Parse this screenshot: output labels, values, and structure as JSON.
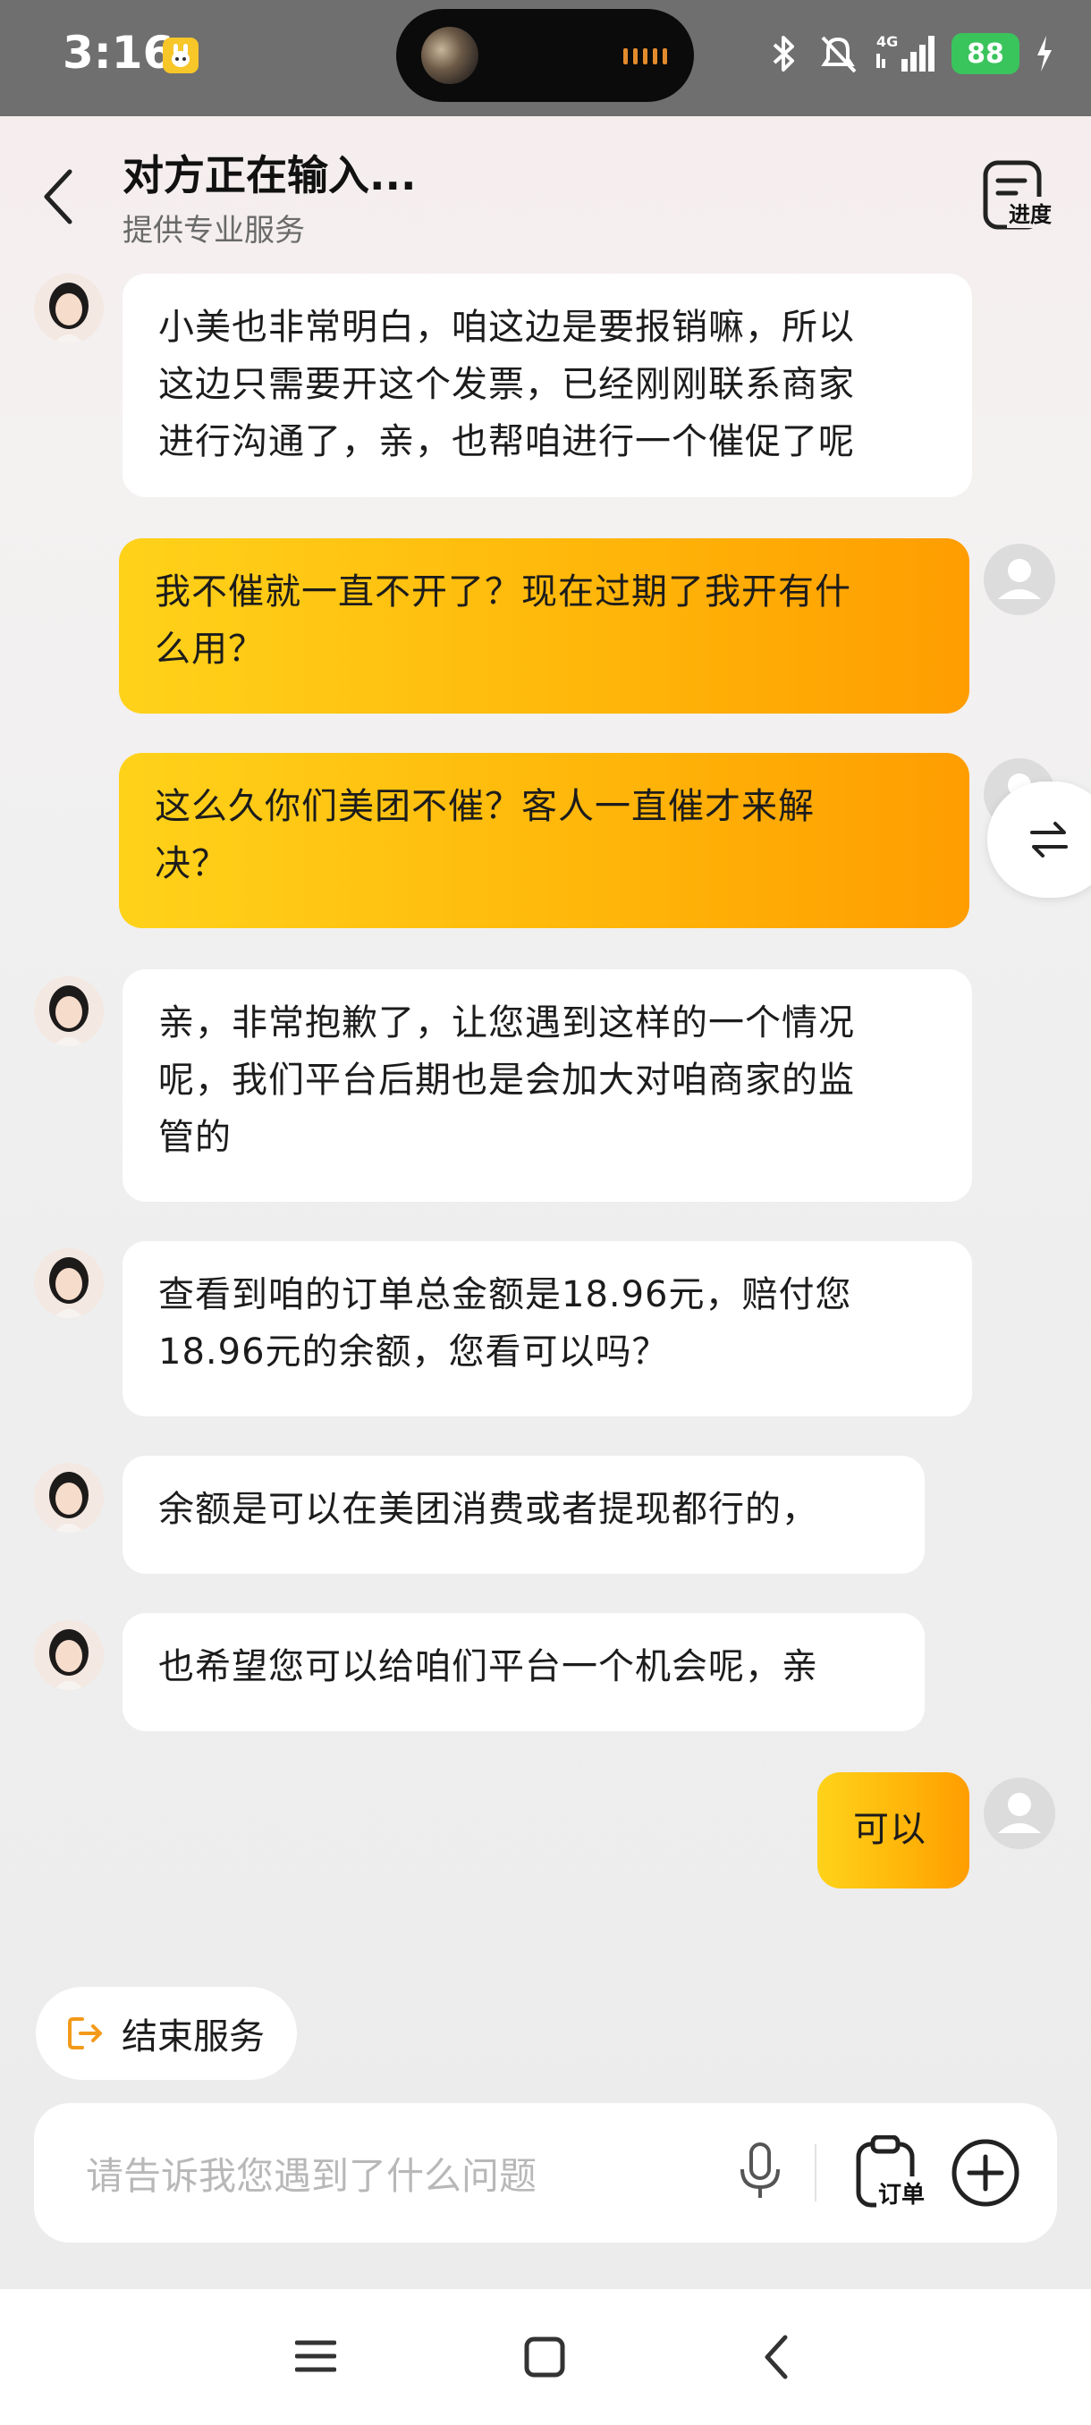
{
  "status_bar": {
    "time": "3:16",
    "network": "4G",
    "battery": "88"
  },
  "header": {
    "title": "对方正在输入...",
    "subtitle": "提供专业服务",
    "progress_label": "进度"
  },
  "messages": [
    {
      "from": "agent",
      "lines": [
        "小美也非常明白，咱这边是要报销嘛，所以",
        "这边只需要开这个发票，已经刚刚联系商家",
        "进行沟通了，亲，也帮咱进行一个催促了呢"
      ]
    },
    {
      "from": "user",
      "lines": [
        "我不催就一直不开了？现在过期了我开有什",
        "么用？"
      ]
    },
    {
      "from": "user",
      "lines": [
        "这么久你们美团不催？客人一直催才来解",
        "决？"
      ]
    },
    {
      "from": "agent",
      "lines": [
        "亲，非常抱歉了，让您遇到这样的一个情况",
        "呢，我们平台后期也是会加大对咱商家的监",
        "管的"
      ]
    },
    {
      "from": "agent",
      "lines": [
        "查看到咱的订单总金额是18.96元，赔付您",
        "18.96元的余额，您看可以吗？"
      ]
    },
    {
      "from": "agent",
      "lines": [
        "余额是可以在美团消费或者提现都行的，"
      ]
    },
    {
      "from": "agent",
      "lines": [
        "也希望您可以给咱们平台一个机会呢，亲"
      ]
    },
    {
      "from": "user",
      "lines": [
        "可以"
      ]
    }
  ],
  "end_service": {
    "label": "结束服务"
  },
  "input": {
    "placeholder": "请告诉我您遇到了什么问题",
    "order_label": "订单"
  },
  "colors": {
    "user_bubble_start": "#ffd21a",
    "user_bubble_end": "#ff9d00",
    "accent_orange": "#f39a1a",
    "battery_green": "#3ac45c"
  },
  "icons": [
    "back-arrow-icon",
    "progress-doc-icon",
    "swap-icon",
    "exit-icon",
    "microphone-icon",
    "order-clipboard-icon",
    "plus-circle-icon",
    "menu-icon",
    "home-square-icon",
    "nav-back-icon"
  ]
}
